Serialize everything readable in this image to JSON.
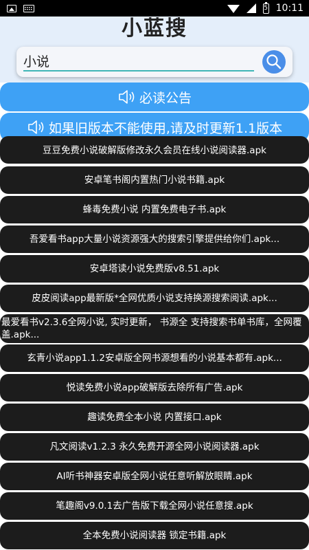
{
  "status_bar": {
    "time": "10:11",
    "battery": "5"
  },
  "app": {
    "title": "小蓝搜"
  },
  "search": {
    "value": "小说",
    "button_icon": "search-icon"
  },
  "notices": [
    {
      "icon": "speaker-icon",
      "label": "必读公告"
    },
    {
      "icon": "speaker-icon",
      "label": "如果旧版本不能使用,请及时更新1.1版本"
    }
  ],
  "results": [
    {
      "label": "豆豆免费小说破解版修改永久会员在线小说阅读器.apk"
    },
    {
      "label": "安卓笔书阁内置热门小说书籍.apk"
    },
    {
      "label": "蜂毒免费小说 内置免费电子书.apk"
    },
    {
      "label": "吾爱看书app大量小说资源强大的搜索引擎提供给你们.apk..."
    },
    {
      "label": "安卓塔读小说免费版v8.51.apk"
    },
    {
      "label": "皮皮阅读app最新版*全网优质小说支持换源搜索阅读.apk..."
    },
    {
      "label": "最爱看书v2.3.6全网小说, 实时更新， 书源全 支持搜索书单书库，全网覆盖.apk..."
    },
    {
      "label": "玄青小说app1.1.2安卓版全网书源想看的小说基本都有.apk..."
    },
    {
      "label": "悦读免费小说app破解版去除所有广告.apk"
    },
    {
      "label": "趣读免费全本小说 内置接口.apk"
    },
    {
      "label": "凡文阅读v1.2.3 永久免费开源全网小说阅读器.apk"
    },
    {
      "label": "AI听书神器安卓版全网小说任意听解放眼睛.apk"
    },
    {
      "label": "笔趣阁v9.0.1去广告版下载全网小说任意搜.apk"
    },
    {
      "label": "全本免费小说阅读器 锁定书籍.apk"
    }
  ],
  "colors": {
    "header_bg": "#e4eefa",
    "accent": "#3ea1f5",
    "search_button": "#4a8ee8",
    "item_bg": "#1c1c1c"
  }
}
